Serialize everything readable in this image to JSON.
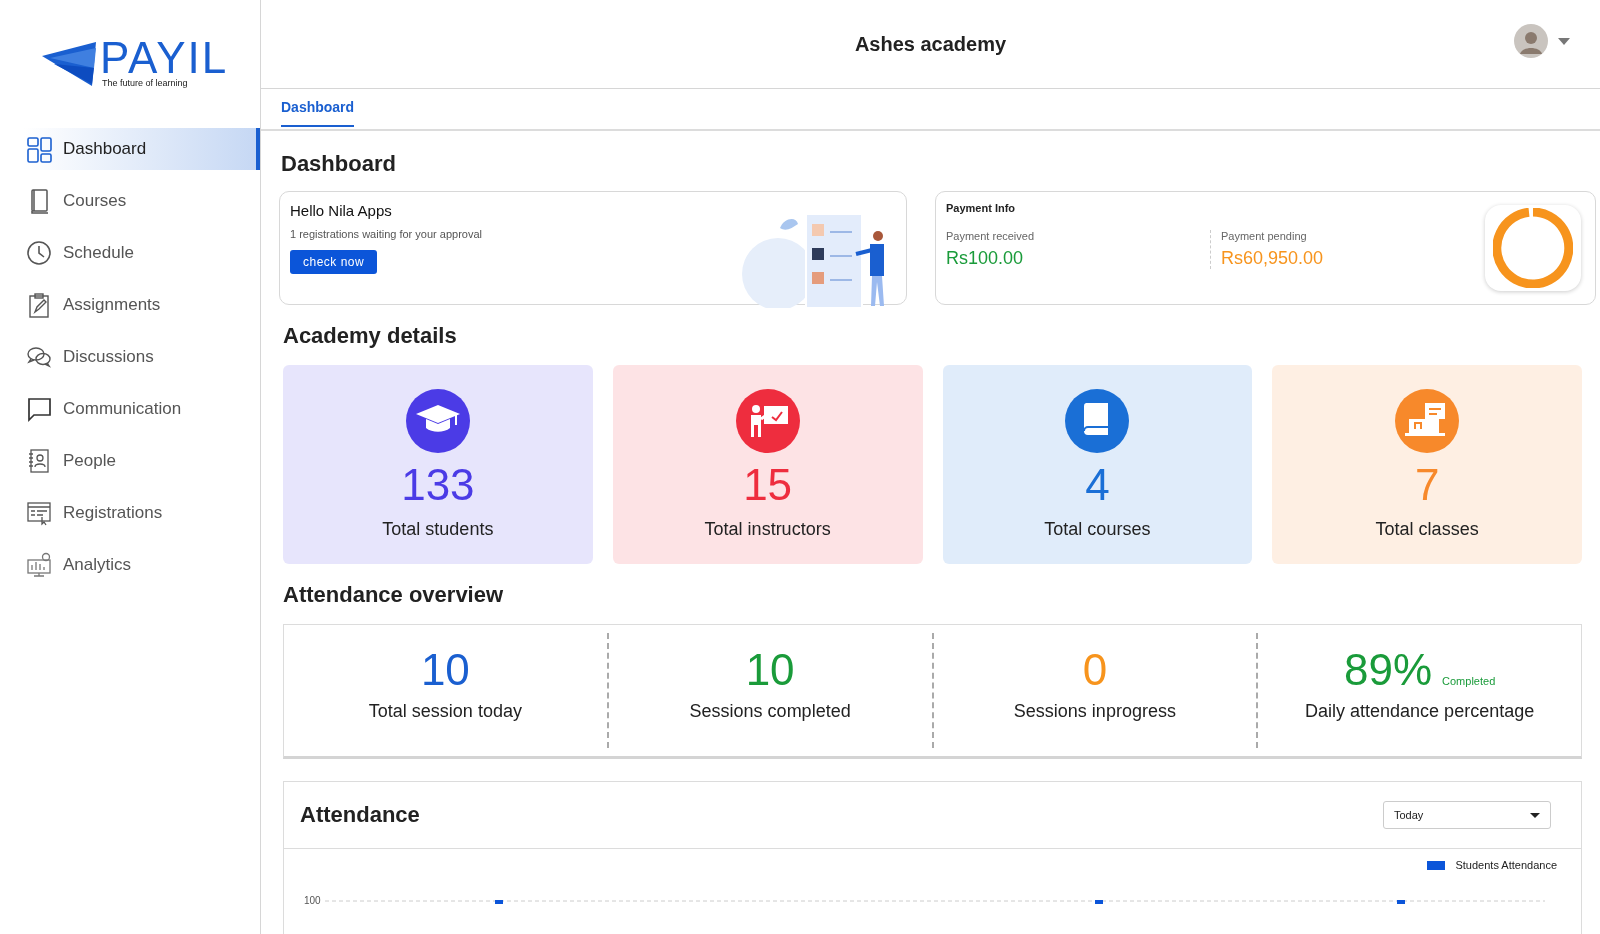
{
  "logo": {
    "name": "PAYIL",
    "tagline": "The future of learning"
  },
  "sidebar": {
    "items": [
      {
        "label": "Dashboard",
        "selected": true
      },
      {
        "label": "Courses",
        "selected": false
      },
      {
        "label": "Schedule",
        "selected": false
      },
      {
        "label": "Assignments",
        "selected": false
      },
      {
        "label": "Discussions",
        "selected": false
      },
      {
        "label": "Communication",
        "selected": false
      },
      {
        "label": "People",
        "selected": false
      },
      {
        "label": "Registrations",
        "selected": false
      },
      {
        "label": "Analytics",
        "selected": false
      }
    ]
  },
  "header": {
    "title": "Ashes academy"
  },
  "tabs": [
    {
      "label": "Dashboard",
      "selected": true
    }
  ],
  "page_title": "Dashboard",
  "welcome": {
    "greeting": "Hello Nila Apps",
    "message": "1 registrations waiting for your approval",
    "button": "check now"
  },
  "payment": {
    "title": "Payment Info",
    "items": [
      {
        "label": "Payment received",
        "amount": "Rs100.00",
        "color": "#1a9b3a"
      },
      {
        "label": "Payment pending",
        "amount": "Rs60,950.00",
        "color": "#f7941d"
      }
    ]
  },
  "academy": {
    "title": "Academy details",
    "cards": [
      {
        "value": "133",
        "label": "Total students",
        "color": "#4b3be6"
      },
      {
        "value": "15",
        "label": "Total instructors",
        "color": "#ee2d3e"
      },
      {
        "value": "4",
        "label": "Total courses",
        "color": "#1a6fd6"
      },
      {
        "value": "7",
        "label": "Total classes",
        "color": "#f7892b"
      }
    ]
  },
  "attendance_overview": {
    "title": "Attendance overview",
    "items": [
      {
        "value": "10",
        "label": "Total session today",
        "color": "#1a5fd0"
      },
      {
        "value": "10",
        "label": "Sessions completed",
        "color": "#1a9b3a"
      },
      {
        "value": "0",
        "label": "Sessions inprogress",
        "color": "#f7941d"
      },
      {
        "value": "89%",
        "note": "Completed",
        "label": "Daily attendance percentage",
        "color": "#1a9b3a"
      }
    ]
  },
  "attendance": {
    "title": "Attendance",
    "filter": "Today",
    "legend": "Students Attendance",
    "y_tick": "100"
  }
}
